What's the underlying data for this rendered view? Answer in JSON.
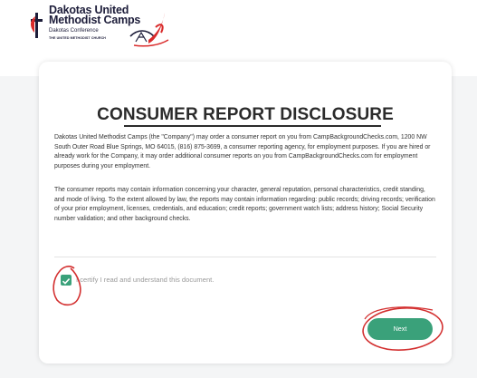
{
  "header": {
    "logo": {
      "line1": "Dakotas United",
      "line2": "Methodist Camps",
      "line3": "Dakotas Conference",
      "line4": "THE UNITED METHODIST CHURCH"
    }
  },
  "card": {
    "title": "CONSUMER REPORT DISCLOSURE",
    "paragraph1": "Dakotas United Methodist Camps (the \"Company\") may order a consumer report on you from CampBackgroundChecks.com, 1200 NW South Outer Road Blue Springs, MO 64015, (816) 875-3699, a consumer reporting agency, for employment purposes. If you are hired or already work for the Company, it may order additional consumer reports on you from CampBackgroundChecks.com for employment purposes during your employment.",
    "paragraph2": "The consumer reports may contain information concerning your character, general reputation, personal characteristics, credit standing, and mode of living. To the extent allowed by law, the reports may contain information regarding: public records; driving records; verification of your prior employment, licenses, credentials, and education; credit reports; government watch lists; address history; Social Security number validation; and other background checks.",
    "certify_checked": true,
    "certify_label": "I certify I read and understand this document.",
    "next_label": "Next"
  },
  "colors": {
    "accent": "#3aa17a",
    "annotation": "#d32f2f",
    "logo_red": "#d92a2a"
  }
}
